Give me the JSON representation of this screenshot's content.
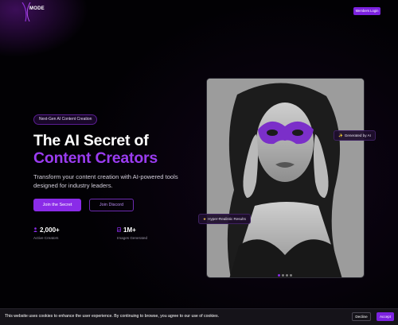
{
  "header": {
    "logo_text": "MODE",
    "members_label": "Members Login"
  },
  "hero": {
    "badge": "Next-Gen AI Content Creation",
    "title_line1": "The AI Secret of",
    "title_line2": "Content Creators",
    "subtitle": "Transform your content creation with AI-powered tools designed for industry leaders.",
    "primary_cta": "Join the Secret",
    "secondary_cta": "Join Discord",
    "stats": [
      {
        "value": "2,000+",
        "label": "Active Creators",
        "icon": "users-icon"
      },
      {
        "value": "1M+",
        "label": "Images Generated",
        "icon": "image-icon"
      }
    ]
  },
  "showcase": {
    "chip_generated": "Generated by AI",
    "chip_hyper": "Hyper-Realistic Results",
    "carousel": {
      "count": 4,
      "active": 0
    }
  },
  "cookie": {
    "text": "This website uses cookies to enhance the user experience. By continuing to browse, you agree to our use of cookies.",
    "decline": "Decline",
    "accept": "Accept"
  },
  "colors": {
    "accent": "#8a2be8",
    "background": "#020104"
  }
}
